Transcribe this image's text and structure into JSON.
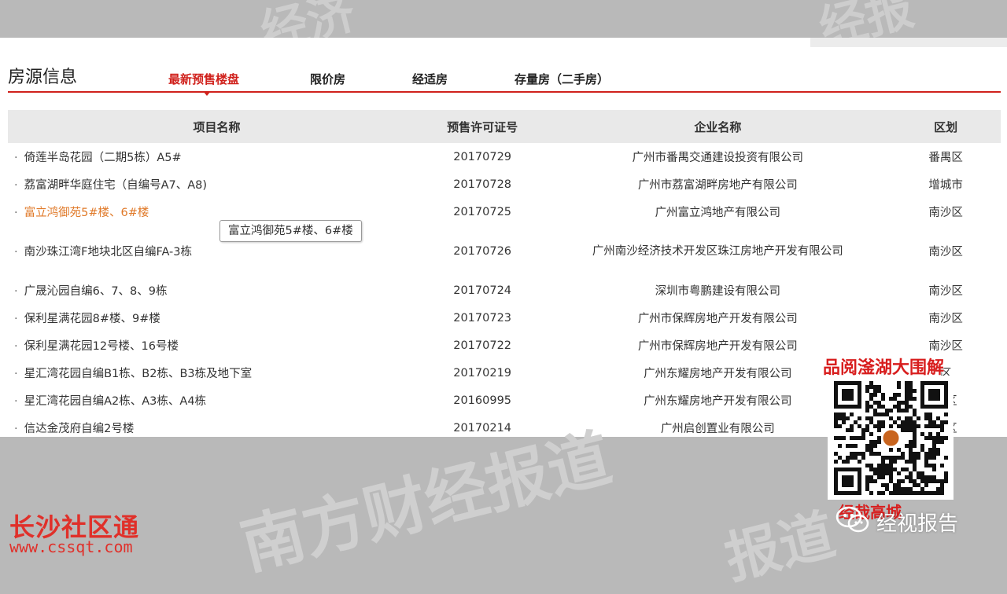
{
  "watermark": {
    "top_left": "经济",
    "top_right": "经报",
    "bottom": "南方财经报道",
    "bottom_right": "报道"
  },
  "header": {
    "title": "房源信息",
    "tabs": [
      {
        "label": "最新预售楼盘",
        "active": true
      },
      {
        "label": "限价房",
        "active": false
      },
      {
        "label": "经适房",
        "active": false
      },
      {
        "label": "存量房（二手房）",
        "active": false
      }
    ]
  },
  "table": {
    "columns": [
      "项目名称",
      "预售许可证号",
      "企业名称",
      "区划"
    ],
    "rows": [
      {
        "name": "倚莲半岛花园（二期5栋）A5#",
        "permit": "20170729",
        "company": "广州市番禺交通建设投资有限公司",
        "district": "番禺区"
      },
      {
        "name": "荔富湖畔华庭住宅（自编号A7、A8)",
        "permit": "20170728",
        "company": "广州市荔富湖畔房地产有限公司",
        "district": "增城市"
      },
      {
        "name": "富立鸿御苑5#楼、6#楼",
        "permit": "20170725",
        "company": "广州富立鸿地产有限公司",
        "district": "南沙区"
      },
      {
        "name": "南沙珠江湾F地块北区自编FA-3栋",
        "permit": "20170726",
        "company": "广州南沙经济技术开发区珠江房地产开发有限公司",
        "district": "南沙区"
      },
      {
        "name": "广晟沁园自编6、7、8、9栋",
        "permit": "20170724",
        "company": "深圳市粤鹏建设有限公司",
        "district": "南沙区"
      },
      {
        "name": "保利星满花园8#楼、9#楼",
        "permit": "20170723",
        "company": "广州市保辉房地产开发有限公司",
        "district": "南沙区"
      },
      {
        "name": "保利星满花园12号楼、16号楼",
        "permit": "20170722",
        "company": "广州市保辉房地产开发有限公司",
        "district": "南沙区"
      },
      {
        "name": "星汇湾花园自编B1栋、B2栋、B3栋及地下室",
        "permit": "20170219",
        "company": "广州东耀房地产开发有限公司",
        "district": "区"
      },
      {
        "name": "星汇湾花园自编A2栋、A3栋、A4栋",
        "permit": "20160995",
        "company": "广州东耀房地产开发有限公司",
        "district": "珠区"
      },
      {
        "name": "信达金茂府自编2号楼",
        "permit": "20170214",
        "company": "广州启创置业有限公司",
        "district": "河区"
      }
    ]
  },
  "tooltip": {
    "text": "富立鸿御苑5#楼、6#楼"
  },
  "qr": {
    "caption_top": "品阅滏湖大围解",
    "caption_bottom": "经哉高城"
  },
  "brand_left": {
    "name": "长沙社区通",
    "url": "www.cssqt.com"
  },
  "brand_right": {
    "name": "经视报告"
  },
  "colors": {
    "accent": "#d0211c",
    "hover_link": "#e07a2a",
    "brand_red": "#e0302a"
  }
}
